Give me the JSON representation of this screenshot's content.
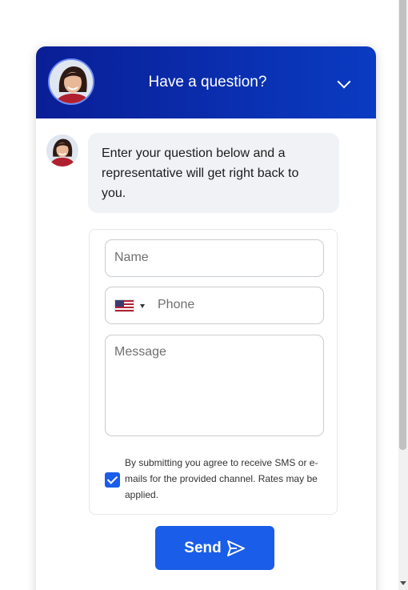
{
  "header": {
    "title": "Have a question?",
    "avatar_alt": "representative-avatar",
    "toggle_icon": "chevron-down-icon"
  },
  "chat": {
    "greeting": "Enter your question below and a representative will get right back to you."
  },
  "form": {
    "name_placeholder": "Name",
    "phone_placeholder": "Phone",
    "phone_country": "US",
    "message_placeholder": "Message",
    "consent_checked": true,
    "consent_text": "By submitting you agree to receive SMS or e-mails for the provided channel. Rates may be applied."
  },
  "send": {
    "label": "Send",
    "icon": "send-icon"
  },
  "colors": {
    "header_start": "#0a1e96",
    "header_end": "#0a3bc2",
    "accent": "#1a5de8"
  }
}
